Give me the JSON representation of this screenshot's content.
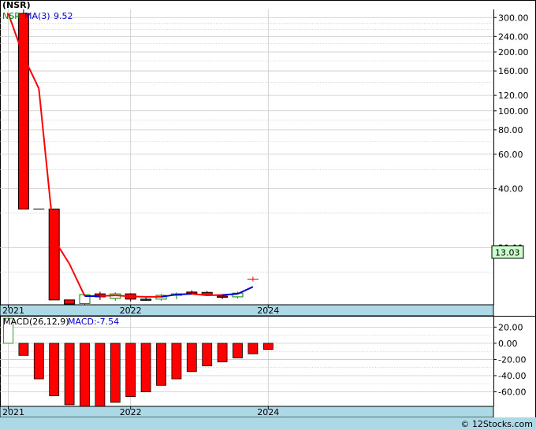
{
  "header": {
    "title": "(NSR)",
    "legend_symbol": "NSR",
    "legend_ma_label": "MA(3)",
    "legend_ma_value": "9.52"
  },
  "macd_header": {
    "label": "MACD(26,12,9)",
    "value_label": "MACD:-7.54"
  },
  "footer": {
    "copyright": "© 12Stocks.com"
  },
  "colors": {
    "up_fill": "#ffffff",
    "up_stroke": "#008000",
    "down_fill": "#ff0000",
    "down_stroke": "#000000",
    "ma_down": "#ff0000",
    "ma_up": "#0000cc",
    "macd_bar": "#ff0000",
    "macd_pos_stroke": "#008000",
    "axis_band": "#add8e6",
    "grid": "#c8c8c8",
    "last_price_box": "#ccffcc",
    "legend_symbol": "#008000",
    "legend_ma": "#0000cc"
  },
  "chart_data": [
    {
      "type": "candlestick",
      "title": "(NSR)",
      "frequency": "quarterly",
      "y_scale": "log",
      "ylim": [
        10.2,
        330
      ],
      "yticks": [
        300,
        240,
        200,
        160,
        120,
        100,
        80,
        60,
        40,
        20
      ],
      "ytick_labels": [
        "300.00",
        "240.00",
        "200.00",
        "160.00",
        "120.00",
        "100.00",
        "80.00",
        "60.00",
        "40.00",
        "20.00"
      ],
      "x_labels": [
        "2021",
        "2022",
        "2024"
      ],
      "last_price": 13.03,
      "last_price_label": "13.03",
      "candles": [
        {
          "o": 315,
          "h": 330,
          "l": 31.5,
          "c": 31.5
        },
        {
          "o": 31.5,
          "h": 31.5,
          "l": 31.5,
          "c": 31.5
        },
        {
          "o": 31.5,
          "h": 31.5,
          "l": 10.8,
          "c": 10.8
        },
        {
          "o": 10.8,
          "h": 10.8,
          "l": 10.2,
          "c": 10.3
        },
        {
          "o": 10.35,
          "h": 11.6,
          "l": 10.1,
          "c": 11.5
        },
        {
          "o": 11.6,
          "h": 11.9,
          "l": 10.8,
          "c": 11.2
        },
        {
          "o": 11.0,
          "h": 11.8,
          "l": 10.7,
          "c": 11.6
        },
        {
          "o": 11.6,
          "h": 11.7,
          "l": 10.6,
          "c": 10.9
        },
        {
          "o": 10.9,
          "h": 11.2,
          "l": 10.7,
          "c": 10.85
        },
        {
          "o": 10.9,
          "h": 11.6,
          "l": 10.7,
          "c": 11.4
        },
        {
          "o": 11.4,
          "h": 11.8,
          "l": 10.9,
          "c": 11.6
        },
        {
          "o": 11.85,
          "h": 12.1,
          "l": 11.5,
          "c": 11.75
        },
        {
          "o": 11.8,
          "h": 12.0,
          "l": 11.3,
          "c": 11.45
        },
        {
          "o": 11.3,
          "h": 11.5,
          "l": 10.9,
          "c": 11.2
        },
        {
          "o": 11.2,
          "h": 11.9,
          "l": 11.0,
          "c": 11.7
        },
        {
          "o": 13.8,
          "h": 13.8,
          "l": 13.8,
          "c": 13.8
        }
      ],
      "ma": {
        "name": "MA(3)",
        "values": [
          315,
          190,
          130,
          22,
          16.5,
          11.3,
          11.3,
          11.4,
          11.25,
          11.2,
          11.2,
          11.5,
          11.6,
          11.4,
          11.45,
          11.6,
          12.6
        ],
        "direction": [
          "down",
          "down",
          "down",
          "down",
          "down",
          "up",
          "down",
          "down",
          "down",
          "down",
          "up",
          "up",
          "down",
          "down",
          "up",
          "up"
        ]
      }
    },
    {
      "type": "bar",
      "title": "MACD(26,12,9)",
      "ylim": [
        -78,
        33
      ],
      "yticks": [
        20,
        0,
        -20,
        -40,
        -60
      ],
      "ytick_labels": [
        "20.00",
        "0.00",
        "-20.00",
        "-40.00",
        "-60.00"
      ],
      "x_labels": [
        "2021",
        "2022",
        "2024"
      ],
      "values": [
        31,
        -15,
        -44,
        -65,
        -76,
        -78,
        -78,
        -73,
        -66,
        -60,
        -52,
        -44,
        -35,
        -28,
        -23,
        -18,
        -13,
        -7.54
      ]
    }
  ]
}
